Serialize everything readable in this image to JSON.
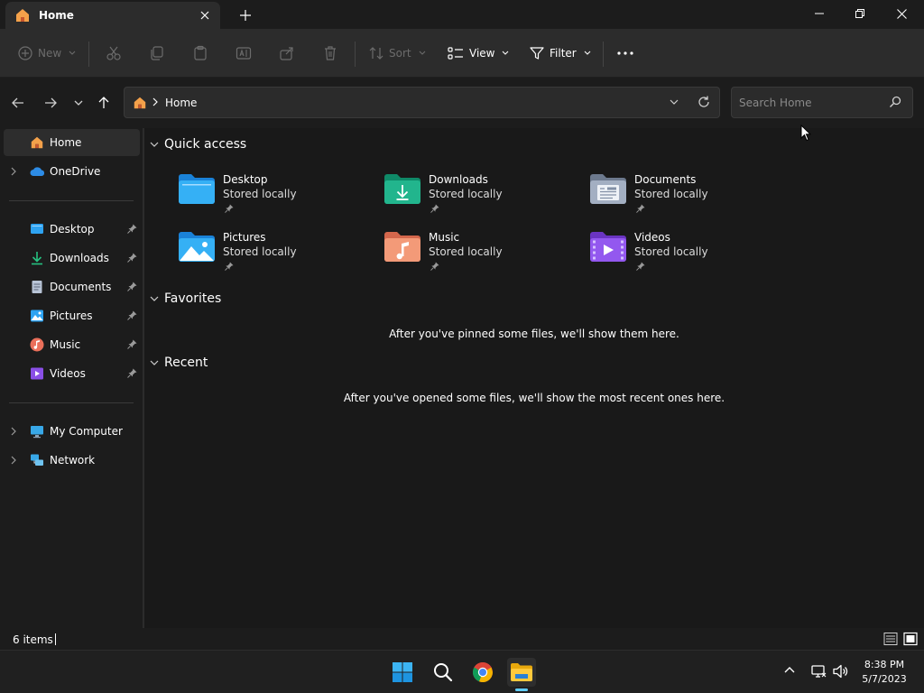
{
  "window": {
    "tab_title": "Home"
  },
  "command_bar": {
    "new_label": "New",
    "sort_label": "Sort",
    "view_label": "View",
    "filter_label": "Filter"
  },
  "address_bar": {
    "crumb": "Home",
    "search_placeholder": "Search Home"
  },
  "sidebar": {
    "top_items": [
      {
        "label": "Home",
        "icon": "home-icon",
        "selected": true
      },
      {
        "label": "OneDrive",
        "icon": "cloud-icon",
        "expandable": true
      }
    ],
    "pinned_items": [
      {
        "label": "Desktop",
        "icon": "desktop-folder-icon"
      },
      {
        "label": "Downloads",
        "icon": "download-icon"
      },
      {
        "label": "Documents",
        "icon": "documents-icon"
      },
      {
        "label": "Pictures",
        "icon": "pictures-icon"
      },
      {
        "label": "Music",
        "icon": "music-icon"
      },
      {
        "label": "Videos",
        "icon": "videos-icon"
      }
    ],
    "bottom_items": [
      {
        "label": "My Computer",
        "icon": "computer-icon",
        "expandable": true
      },
      {
        "label": "Network",
        "icon": "network-icon",
        "expandable": true
      }
    ]
  },
  "main": {
    "quick_access": {
      "heading": "Quick access",
      "tiles": [
        {
          "name": "Desktop",
          "sub": "Stored locally",
          "icon": "desktop-folder-icon"
        },
        {
          "name": "Downloads",
          "sub": "Stored locally",
          "icon": "downloads-folder-icon"
        },
        {
          "name": "Documents",
          "sub": "Stored locally",
          "icon": "documents-folder-icon"
        },
        {
          "name": "Pictures",
          "sub": "Stored locally",
          "icon": "pictures-folder-icon"
        },
        {
          "name": "Music",
          "sub": "Stored locally",
          "icon": "music-folder-icon"
        },
        {
          "name": "Videos",
          "sub": "Stored locally",
          "icon": "videos-folder-icon"
        }
      ]
    },
    "favorites": {
      "heading": "Favorites",
      "empty_message": "After you've pinned some files, we'll show them here."
    },
    "recent": {
      "heading": "Recent",
      "empty_message": "After you've opened some files, we'll show the most recent ones here."
    }
  },
  "status_bar": {
    "item_count": "6 items"
  },
  "taskbar": {
    "time": "8:38 PM",
    "date": "5/7/2023"
  },
  "colors": {
    "accent": "#60cdff",
    "folder_blue": "#2ea3f2",
    "folder_green": "#1db48a",
    "folder_gray": "#9aa6b8",
    "folder_orange": "#f08a5d",
    "folder_purple": "#8a4fe6"
  }
}
